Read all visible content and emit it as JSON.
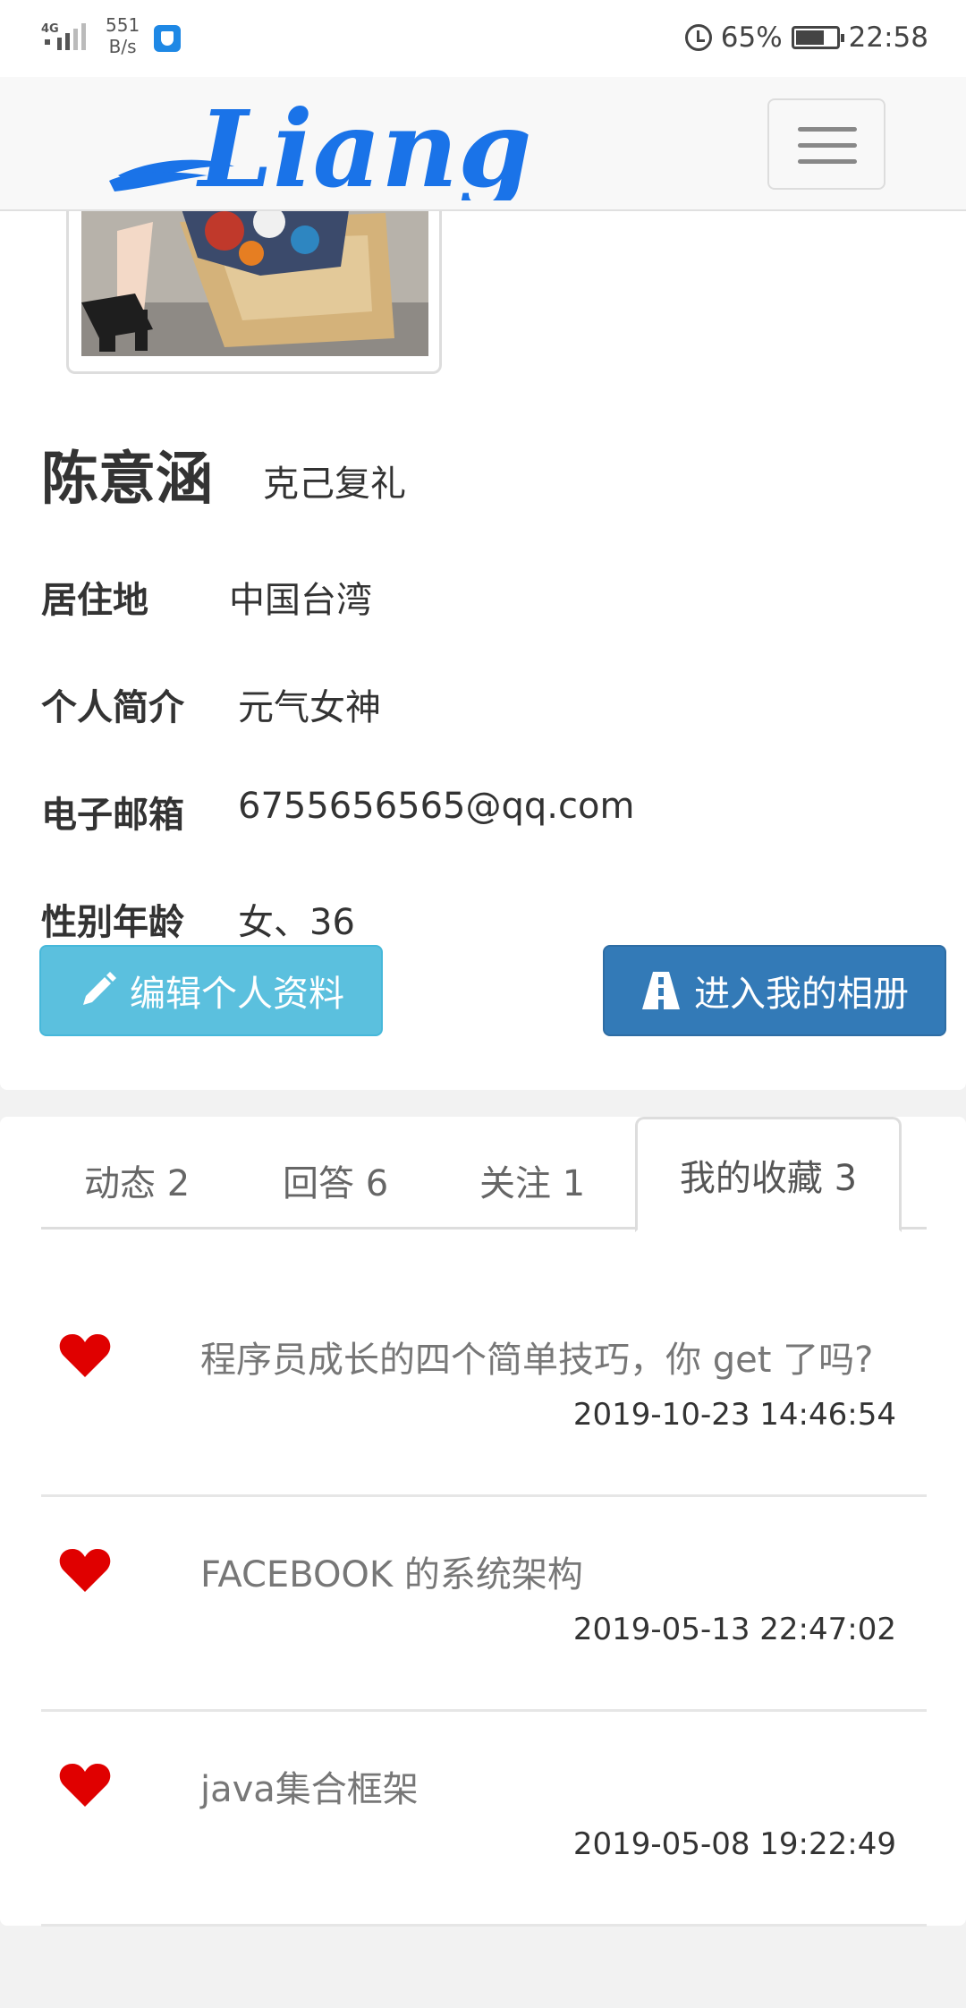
{
  "status_bar": {
    "net_speed_value": "551",
    "net_speed_unit": "B/s",
    "battery": "65%",
    "time": "22:58",
    "network": "4G"
  },
  "navbar": {
    "logo_text": "Liang",
    "logo_color": "#1a73e8",
    "menu_icon": "hamburger-menu-icon"
  },
  "profile": {
    "name": "陈意涵",
    "motto": "克己复礼",
    "fields": [
      {
        "label": "居住地",
        "value": "中国台湾"
      },
      {
        "label": "个人简介",
        "value": "元气女神"
      },
      {
        "label": "电子邮箱",
        "value": "6755656565@qq.com"
      },
      {
        "label": "性别年龄",
        "value": "女、36"
      }
    ],
    "edit_button": "编辑个人资料",
    "album_button": "进入我的相册",
    "edit_icon": "pencil-icon",
    "album_icon": "road-icon",
    "edit_color": "#5bc0de",
    "album_color": "#337ab7"
  },
  "tabs": [
    {
      "label": "动态 2"
    },
    {
      "label": "回答 6"
    },
    {
      "label": "关注 1"
    },
    {
      "label": "我的收藏 3"
    }
  ],
  "favorites": [
    {
      "title": "程序员成长的四个简单技巧，你 get 了吗?",
      "time": "2019-10-23 14:46:54"
    },
    {
      "title": "FACEBOOK 的系统架构",
      "time": "2019-05-13 22:47:02"
    },
    {
      "title": "java集合框架",
      "time": "2019-05-08 19:22:49"
    }
  ],
  "heart_color": "#e00000"
}
